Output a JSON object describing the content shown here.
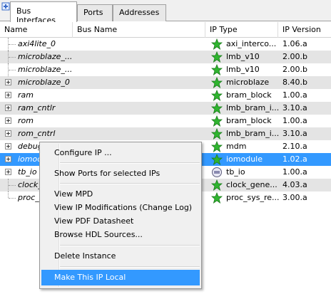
{
  "tabs": [
    {
      "label": "Bus Interfaces"
    },
    {
      "label": "Ports"
    },
    {
      "label": "Addresses"
    }
  ],
  "columns": {
    "name": "Name",
    "bus_name": "Bus Name",
    "ip_type": "IP Type",
    "ip_version": "IP Version"
  },
  "rows": [
    {
      "name": "axi4lite_0",
      "ip_type": "axi_interco...",
      "ip_version": "1.06.a"
    },
    {
      "name": "microblaze_...",
      "ip_type": "lmb_v10",
      "ip_version": "2.00.b"
    },
    {
      "name": "microblaze_...",
      "ip_type": "lmb_v10",
      "ip_version": "2.00.b"
    },
    {
      "name": "microblaze_0",
      "ip_type": "microblaze",
      "ip_version": "8.40.b"
    },
    {
      "name": "ram",
      "ip_type": "bram_block",
      "ip_version": "1.00.a"
    },
    {
      "name": "ram_cntlr",
      "ip_type": "lmb_bram_i...",
      "ip_version": "3.10.a"
    },
    {
      "name": "rom",
      "ip_type": "bram_block",
      "ip_version": "1.00.a"
    },
    {
      "name": "rom_cntrl",
      "ip_type": "lmb_bram_i...",
      "ip_version": "3.10.a"
    },
    {
      "name": "debug_mod...",
      "ip_type": "mdm",
      "ip_version": "2.10.a"
    },
    {
      "name": "iomodule_0",
      "ip_type": "iomodule",
      "ip_version": "1.02.a"
    },
    {
      "name": "tb_io",
      "ip_type": "tb_io",
      "ip_version": "1.00.a"
    },
    {
      "name": "clock_",
      "ip_type": "clock_gene...",
      "ip_version": "4.03.a"
    },
    {
      "name": "proc_s",
      "ip_type": "proc_sys_re...",
      "ip_version": "3.00.a"
    }
  ],
  "context_menu": {
    "items": [
      {
        "label": "Configure IP ..."
      },
      {
        "label": "Show Ports for selected IPs"
      },
      {
        "label": "View MPD"
      },
      {
        "label": "View IP Modifications (Change Log)"
      },
      {
        "label": "View PDF Datasheet"
      },
      {
        "label": "Browse HDL Sources..."
      },
      {
        "label": "Delete Instance"
      },
      {
        "label": "Make This IP Local"
      }
    ]
  },
  "colors": {
    "selection": "#3399ff",
    "alt_row": "#e4e4e4",
    "star_green": "#2fb52f"
  },
  "icons": {
    "tab_icon": "bus-interface-add-icon",
    "ip_status": "green-star-icon",
    "ip_hover": "cursor-hand-icon"
  }
}
